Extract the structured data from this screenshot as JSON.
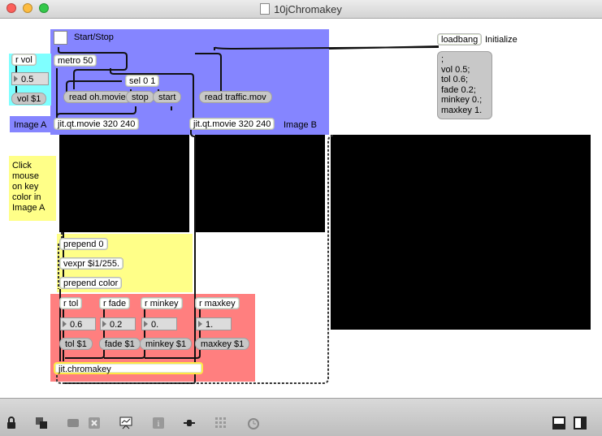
{
  "window": {
    "title": "10jChromakey"
  },
  "colors": {
    "blue_panel": "#8585ff",
    "cyan_panel": "#7fffff",
    "yellow_panel": "#ffff88",
    "red_panel": "#ff7f7f"
  },
  "patch": {
    "start_stop": "Start/Stop",
    "metro": "metro 50",
    "sel": "sel 0 1",
    "read_a": "read oh.movie",
    "stop": "stop",
    "start": "start",
    "read_b": "read traffic.mov",
    "movie_a": "jit.qt.movie 320 240",
    "movie_b": "jit.qt.movie 320 240",
    "image_a": "Image A",
    "image_b": "Image B",
    "r_vol": "r vol",
    "vol_val": "0.5",
    "vol_msg": "vol $1",
    "loadbang": "loadbang",
    "initialize": "Initialize",
    "init_msg": ";\nvol 0.5;\ntol 0.6;\nfade 0.2;\nminkey 0.;\nmaxkey 1.",
    "click_note": "Click\nmouse\non key\ncolor in\nImage A",
    "prepend0": "prepend 0",
    "vexpr": "vexpr $i1/255.",
    "prepend_color": "prepend color",
    "r_tol": "r tol",
    "r_fade": "r fade",
    "r_minkey": "r minkey",
    "r_maxkey": "r maxkey",
    "tol_val": "0.6",
    "fade_val": "0.2",
    "minkey_val": "0.",
    "maxkey_val": "1.",
    "tol_msg": "tol $1",
    "fade_msg": "fade $1",
    "minkey_msg": "minkey $1",
    "maxkey_msg": "maxkey $1",
    "chromakey": "jit.chromakey"
  },
  "toolbar": {
    "icons": [
      "lock-icon",
      "new-object-icon",
      "paste-icon",
      "delete-icon",
      "presentation-icon",
      "info-icon",
      "inspector-icon",
      "grid-icon",
      "clock-icon",
      "panel-left-icon",
      "panel-right-icon"
    ]
  }
}
